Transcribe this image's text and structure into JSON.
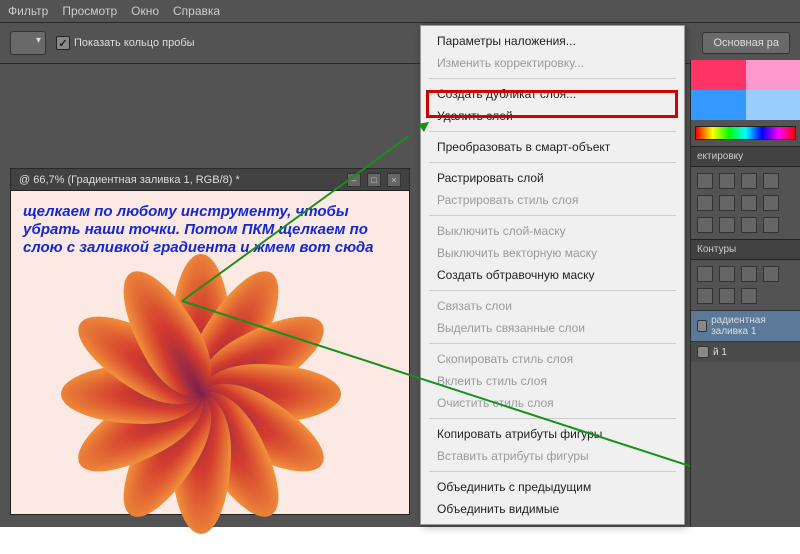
{
  "menubar": {
    "items": [
      "Фильтр",
      "Просмотр",
      "Окно",
      "Справка"
    ]
  },
  "toolbar": {
    "checkbox_label": "Показать кольцо пробы",
    "main_button": "Основная ра"
  },
  "document": {
    "tab_title": "@ 66,7% (Градиентная заливка 1, RGB/8) *"
  },
  "instruction": "щелкаем по любому инструменту, чтобы убрать наши точки. Потом ПКМ щелкаем по слою с заливкой градиента и жмем вот сюда",
  "context_menu": {
    "items": [
      {
        "label": "Параметры наложения...",
        "enabled": true
      },
      {
        "label": "Изменить корректировку...",
        "enabled": false
      },
      {
        "sep": true
      },
      {
        "label": "Создать дубликат слоя...",
        "enabled": true,
        "highlighted": true
      },
      {
        "label": "Удалить слой",
        "enabled": true
      },
      {
        "sep": true
      },
      {
        "label": "Преобразовать в смарт-объект",
        "enabled": true
      },
      {
        "sep": true
      },
      {
        "label": "Растрировать слой",
        "enabled": true
      },
      {
        "label": "Растрировать стиль слоя",
        "enabled": false
      },
      {
        "sep": true
      },
      {
        "label": "Выключить слой-маску",
        "enabled": false
      },
      {
        "label": "Выключить векторную маску",
        "enabled": false
      },
      {
        "label": "Создать обтравочную маску",
        "enabled": true
      },
      {
        "sep": true
      },
      {
        "label": "Связать слои",
        "enabled": false
      },
      {
        "label": "Выделить связанные слои",
        "enabled": false
      },
      {
        "sep": true
      },
      {
        "label": "Скопировать стиль слоя",
        "enabled": false
      },
      {
        "label": "Вклеить стиль слоя",
        "enabled": false
      },
      {
        "label": "Очистить стиль слоя",
        "enabled": false
      },
      {
        "sep": true
      },
      {
        "label": "Копировать атрибуты фигуры",
        "enabled": true
      },
      {
        "label": "Вставить атрибуты фигуры",
        "enabled": false
      },
      {
        "sep": true
      },
      {
        "label": "Объединить с предыдущим",
        "enabled": true
      },
      {
        "label": "Объединить видимые",
        "enabled": true
      }
    ]
  },
  "panels": {
    "corrections_title": "ектировку",
    "channels_title": "Контуры",
    "layer1": "радиентная заливка 1",
    "layer2": "й 1"
  }
}
